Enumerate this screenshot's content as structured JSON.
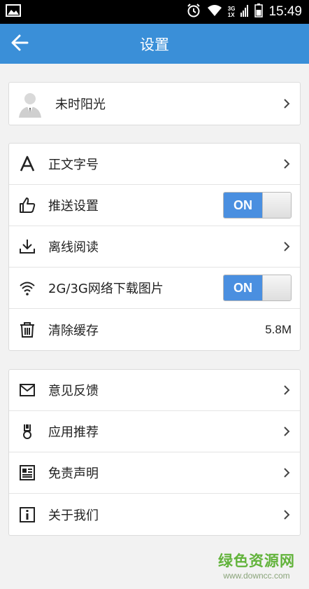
{
  "status_bar": {
    "time": "15:49",
    "net_3g": "3G",
    "net_1x": "1X"
  },
  "app_bar": {
    "title": "设置"
  },
  "profile": {
    "name": "未时阳光"
  },
  "settings": {
    "font_size_label": "正文字号",
    "push_label": "推送设置",
    "push_toggle": "ON",
    "offline_label": "离线阅读",
    "network_images_label": "2G/3G网络下载图片",
    "network_images_toggle": "ON",
    "clear_cache_label": "清除缓存",
    "cache_size": "5.8M"
  },
  "more": {
    "feedback_label": "意见反馈",
    "apps_label": "应用推荐",
    "disclaimer_label": "免责声明",
    "about_label": "关于我们"
  },
  "watermark": {
    "brand": "绿色资源网",
    "url": "www.downcc.com"
  },
  "icons": {
    "back": "arrow-left-icon",
    "font": "letter-a-icon",
    "push": "thumbs-up-icon",
    "offline": "download-icon",
    "wifi": "wifi-icon",
    "trash": "trash-icon",
    "mail": "mail-icon",
    "apps": "medal-icon",
    "doc": "id-card-icon",
    "info": "info-icon"
  },
  "colors": {
    "accent": "#3a8fd8",
    "toggle_on": "#4a8fe0",
    "watermark": "#62b33b"
  }
}
